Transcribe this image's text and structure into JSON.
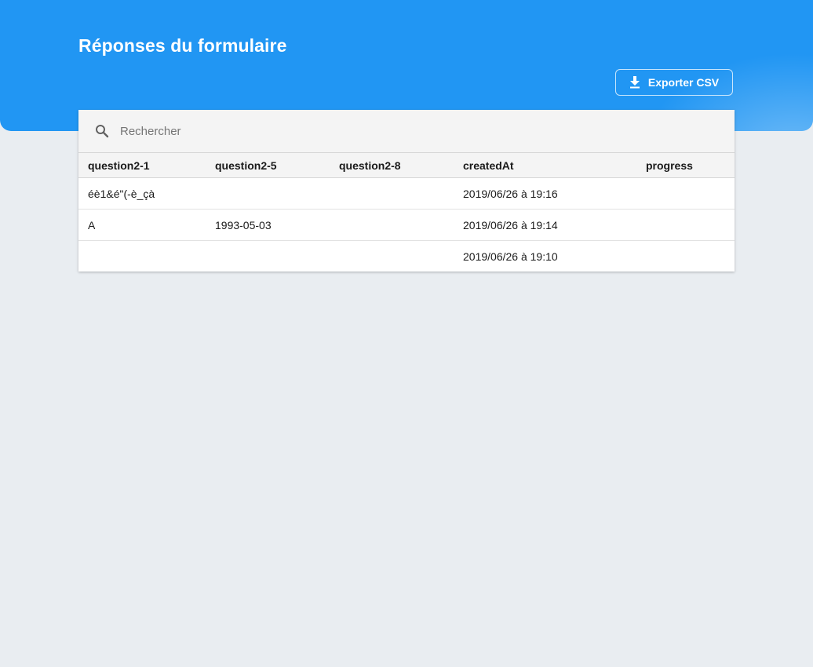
{
  "header": {
    "title": "Réponses du formulaire",
    "export_label": "Exporter CSV",
    "export_icon": "download-icon",
    "background_color": "#2196f3"
  },
  "search": {
    "icon": "search-icon",
    "placeholder": "Rechercher",
    "value": ""
  },
  "table": {
    "columns": [
      "question2-1",
      "question2-5",
      "question2-8",
      "createdAt",
      "progress"
    ],
    "rows": [
      [
        "éè1&é\"(-è_çà",
        "",
        "",
        "2019/06/26 à 19:16",
        ""
      ],
      [
        "A",
        "1993-05-03",
        "",
        "2019/06/26 à 19:14",
        ""
      ],
      [
        "",
        "",
        "",
        "2019/06/26 à 19:10",
        ""
      ]
    ]
  }
}
